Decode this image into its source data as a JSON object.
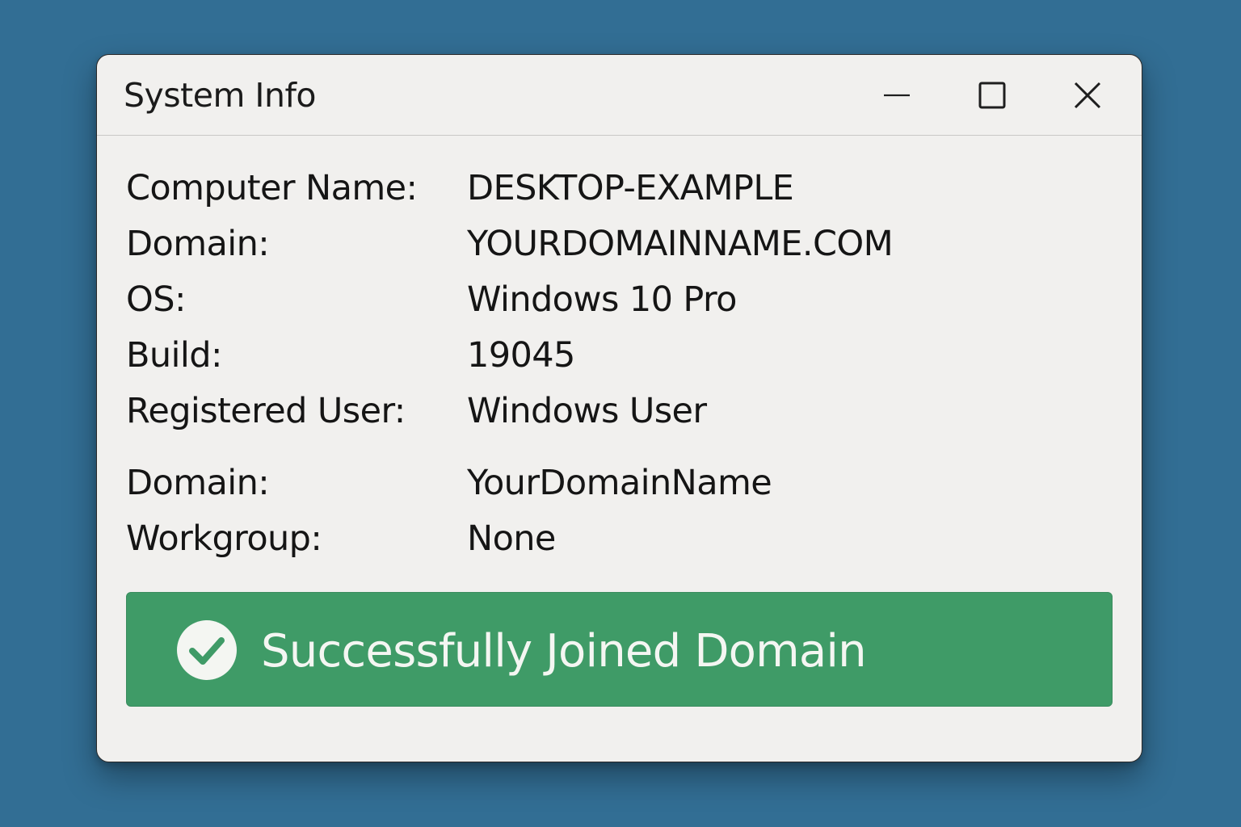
{
  "window": {
    "title": "System Info"
  },
  "info_rows": [
    {
      "label": "Computer Name:",
      "value": "DESKTOP-EXAMPLE"
    },
    {
      "label": "Domain:",
      "value": "YOURDOMAINNAME.COM"
    },
    {
      "label": "OS:",
      "value": "Windows 10 Pro"
    },
    {
      "label": "Build:",
      "value": "19045"
    },
    {
      "label": "Registered User:",
      "value": "Windows User"
    },
    {
      "label": "Domain:",
      "value": "YourDomainName"
    },
    {
      "label": "Workgroup:",
      "value": "None"
    }
  ],
  "status_banner": {
    "text": "Successfully Joined Domain",
    "icon": "check-circle-icon",
    "color": "#3f9b67"
  },
  "colors": {
    "desktop_background": "#326e94",
    "window_background": "#f1f0ee"
  }
}
